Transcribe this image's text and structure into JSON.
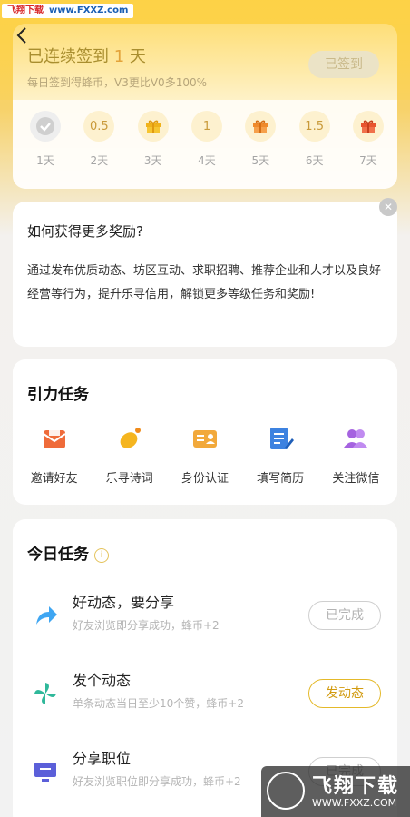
{
  "watermark": {
    "site": "飞翔下载",
    "url": "www.FXXZ.com",
    "brand": "飞翔下载",
    "url_bottom": "WWW.FXXZ.COM"
  },
  "signin": {
    "title_prefix": "已连续签到",
    "streak": "1",
    "title_suffix": "天",
    "subtitle": "每日签到得蜂币，V3更比V0多100%",
    "button": "已签到",
    "days": [
      {
        "reward": "",
        "label": "1天",
        "icon": "check-icon",
        "done": true
      },
      {
        "reward": "0.5",
        "label": "2天"
      },
      {
        "reward": "",
        "label": "3天",
        "icon": "gift-icon-gold"
      },
      {
        "reward": "1",
        "label": "4天"
      },
      {
        "reward": "",
        "label": "5天",
        "icon": "gift-icon-orange"
      },
      {
        "reward": "1.5",
        "label": "6天"
      },
      {
        "reward": "",
        "label": "7天",
        "icon": "gift-icon-red"
      }
    ]
  },
  "rewards": {
    "title": "如何获得更多奖励?",
    "text": "通过发布优质动态、坊区互动、求职招聘、推荐企业和人才以及良好经营等行为，提升乐寻信用，解锁更多等级任务和奖励!"
  },
  "gravity": {
    "title": "引力任务",
    "items": [
      {
        "label": "邀请好友",
        "icon": "invite-mail-icon"
      },
      {
        "label": "乐寻诗词",
        "icon": "lemon-icon"
      },
      {
        "label": "身份认证",
        "icon": "id-card-icon"
      },
      {
        "label": "填写简历",
        "icon": "resume-edit-icon"
      },
      {
        "label": "关注微信",
        "icon": "users-icon"
      }
    ]
  },
  "today": {
    "title": "今日任务",
    "info": "i",
    "tasks": [
      {
        "name": "好动态，要分享",
        "desc": "好友浏览即分享成功，蜂币+2",
        "button": "已完成",
        "state": "done",
        "icon": "share-arrow-icon"
      },
      {
        "name": "发个动态",
        "desc": "单条动态当日至少10个赞，蜂币+2",
        "button": "发动态",
        "state": "go",
        "icon": "pinwheel-icon"
      },
      {
        "name": "分享职位",
        "desc": "好友浏览职位即分享成功，蜂币+2",
        "button": "已完成",
        "state": "done",
        "icon": "monitor-icon"
      }
    ]
  },
  "colors": {
    "accent": "#fdd34a",
    "button_gold": "#d29b10",
    "muted": "#b5b5b5"
  }
}
